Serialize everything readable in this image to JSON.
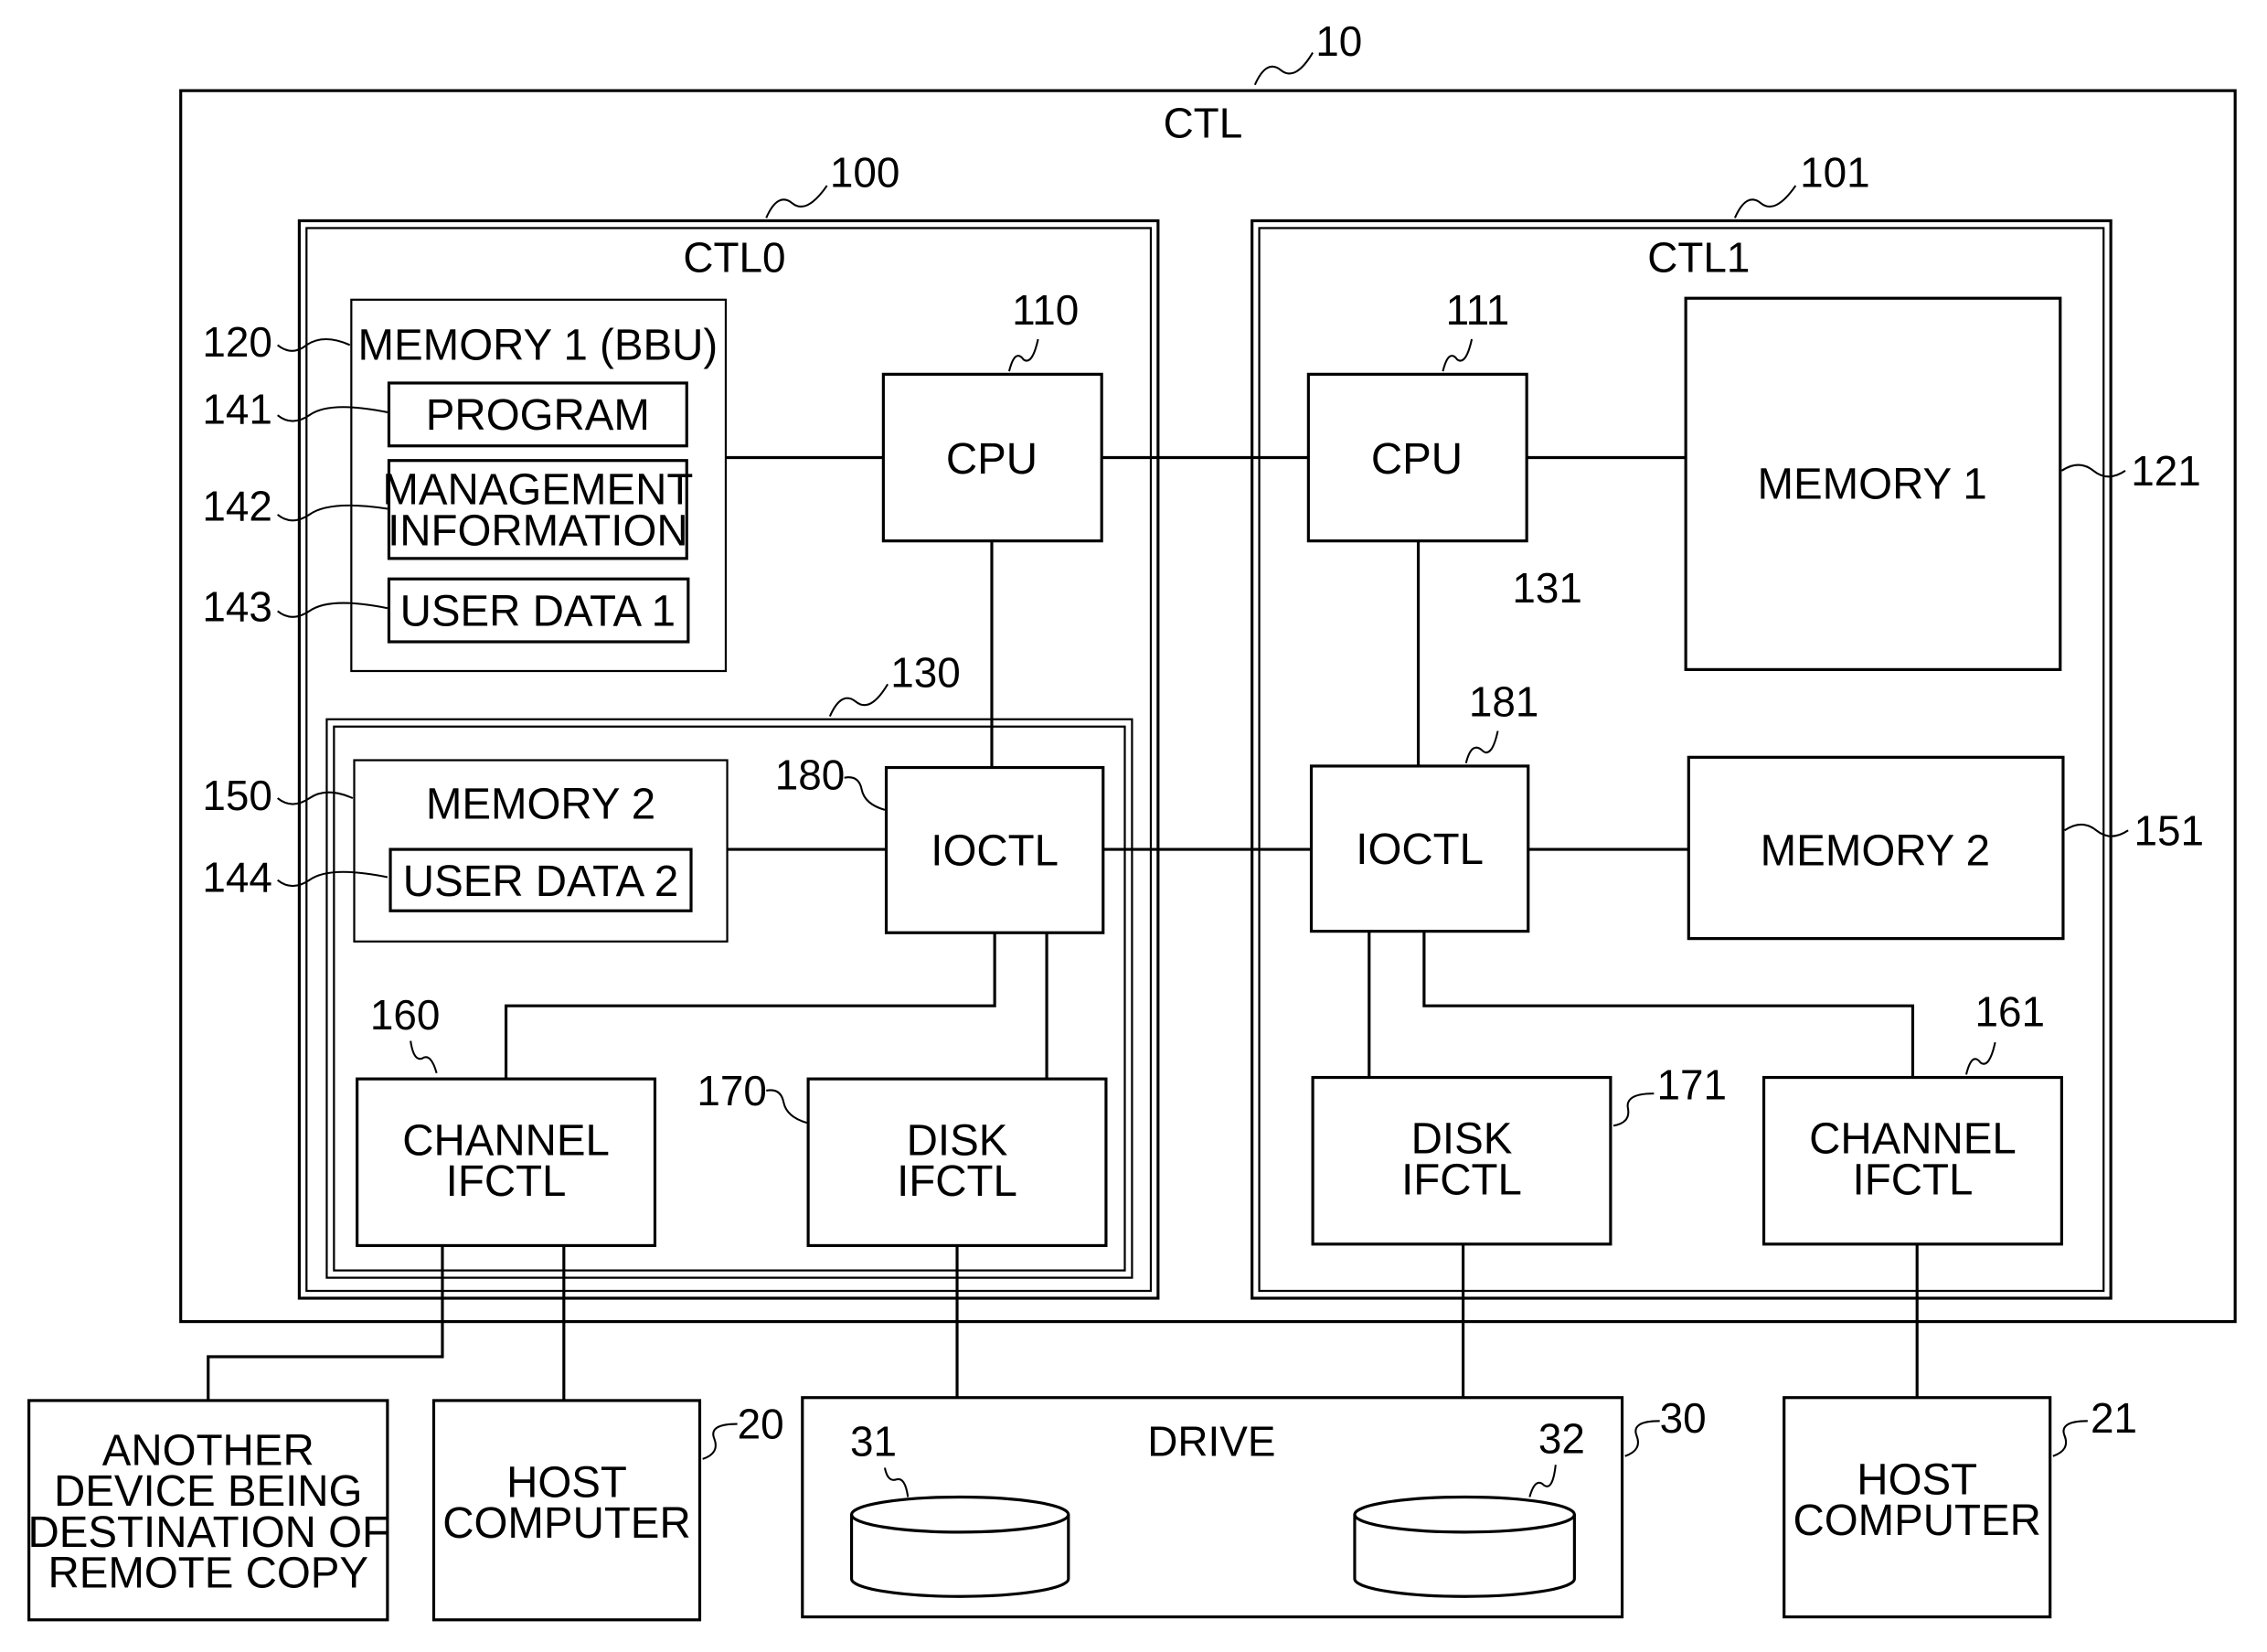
{
  "figure": {
    "system": {
      "label": "CTL",
      "ref": "10"
    },
    "ctl0": {
      "label": "CTL0",
      "ref": "100"
    },
    "ctl1": {
      "label": "CTL1",
      "ref": "101"
    },
    "memory1_bbu": {
      "label": "MEMORY 1 (BBU)",
      "ref": "120"
    },
    "program": {
      "label": "PROGRAM",
      "ref": "141"
    },
    "management_info": {
      "line1": "MANAGEMENT",
      "line2": "INFORMATION",
      "ref": "142"
    },
    "user_data1": {
      "label": "USER DATA 1",
      "ref": "143"
    },
    "group130": {
      "ref": "130"
    },
    "memory2_ctl0": {
      "label": "MEMORY 2",
      "ref": "150"
    },
    "user_data2": {
      "label": "USER DATA 2",
      "ref": "144"
    },
    "cpu0": {
      "label": "CPU",
      "ref": "110"
    },
    "cpu1": {
      "label": "CPU",
      "ref": "111"
    },
    "memory1_ctl1": {
      "label": "MEMORY 1",
      "ref": "121"
    },
    "ref131": "131",
    "ioctl0": {
      "label": "IOCTL",
      "ref": "180"
    },
    "ioctl1": {
      "label": "IOCTL",
      "ref": "181"
    },
    "memory2_ctl1": {
      "label": "MEMORY 2",
      "ref": "151"
    },
    "channel_ifctl0": {
      "line1": "CHANNEL",
      "line2": "IFCTL",
      "ref": "160"
    },
    "disk_ifctl0": {
      "line1": "DISK",
      "line2": "IFCTL",
      "ref": "170"
    },
    "disk_ifctl1": {
      "line1": "DISK",
      "line2": "IFCTL",
      "ref": "171"
    },
    "channel_ifctl1": {
      "line1": "CHANNEL",
      "line2": "IFCTL",
      "ref": "161"
    },
    "remote_device": {
      "line1": "ANOTHER",
      "line2": "DEVICE BEING",
      "line3": "DESTINATION OF",
      "line4": "REMOTE COPY"
    },
    "host0": {
      "line1": "HOST",
      "line2": "COMPUTER",
      "ref": "20"
    },
    "drive": {
      "label": "DRIVE",
      "ref": "30",
      "disk_a_ref": "31",
      "disk_b_ref": "32"
    },
    "host1": {
      "line1": "HOST",
      "line2": "COMPUTER",
      "ref": "21"
    }
  }
}
